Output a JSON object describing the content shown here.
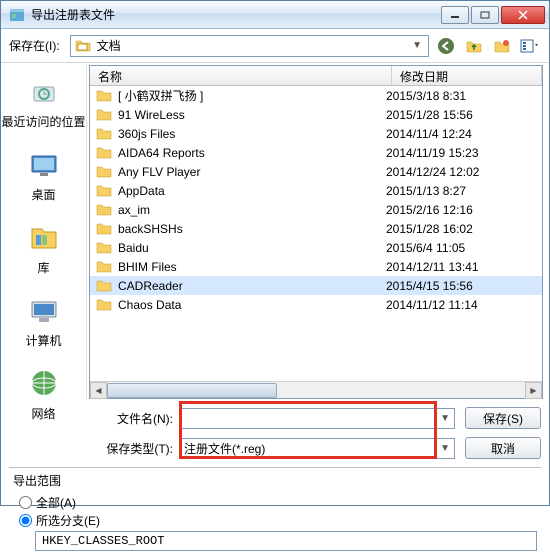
{
  "title": "导出注册表文件",
  "toolbar": {
    "save_in_label": "保存在(I):",
    "location": "文档"
  },
  "sidebar": [
    {
      "label": "最近访问的位置",
      "icon": "recent"
    },
    {
      "label": "桌面",
      "icon": "desktop"
    },
    {
      "label": "库",
      "icon": "libraries"
    },
    {
      "label": "计算机",
      "icon": "computer"
    },
    {
      "label": "网络",
      "icon": "network"
    }
  ],
  "columns": {
    "name": "名称",
    "date": "修改日期"
  },
  "files": [
    {
      "name": "[ 小鹤双拼飞扬 ]",
      "date": "2015/3/18 8:31",
      "sel": false
    },
    {
      "name": "91 WireLess",
      "date": "2015/1/28 15:56",
      "sel": false
    },
    {
      "name": "360js Files",
      "date": "2014/11/4 12:24",
      "sel": false
    },
    {
      "name": "AIDA64 Reports",
      "date": "2014/11/19 15:23",
      "sel": false
    },
    {
      "name": "Any FLV Player",
      "date": "2014/12/24 12:02",
      "sel": false
    },
    {
      "name": "AppData",
      "date": "2015/1/13 8:27",
      "sel": false
    },
    {
      "name": "ax_im",
      "date": "2015/2/16 12:16",
      "sel": false
    },
    {
      "name": "backSHSHs",
      "date": "2015/1/28 16:02",
      "sel": false
    },
    {
      "name": "Baidu",
      "date": "2015/6/4 11:05",
      "sel": false
    },
    {
      "name": "BHIM Files",
      "date": "2014/12/11 13:41",
      "sel": false
    },
    {
      "name": "CADReader",
      "date": "2015/4/15 15:56",
      "sel": true
    },
    {
      "name": "Chaos Data",
      "date": "2014/11/12 11:14",
      "sel": false
    }
  ],
  "form": {
    "filename_label": "文件名(N):",
    "filename_value": "",
    "type_label": "保存类型(T):",
    "type_value": "注册文件(*.reg)",
    "save_btn": "保存(S)",
    "cancel_btn": "取消"
  },
  "export": {
    "title": "导出范围",
    "opt_all": "全部(A)",
    "opt_branch": "所选分支(E)",
    "branch_path": "HKEY_CLASSES_ROOT",
    "selected": "branch"
  }
}
